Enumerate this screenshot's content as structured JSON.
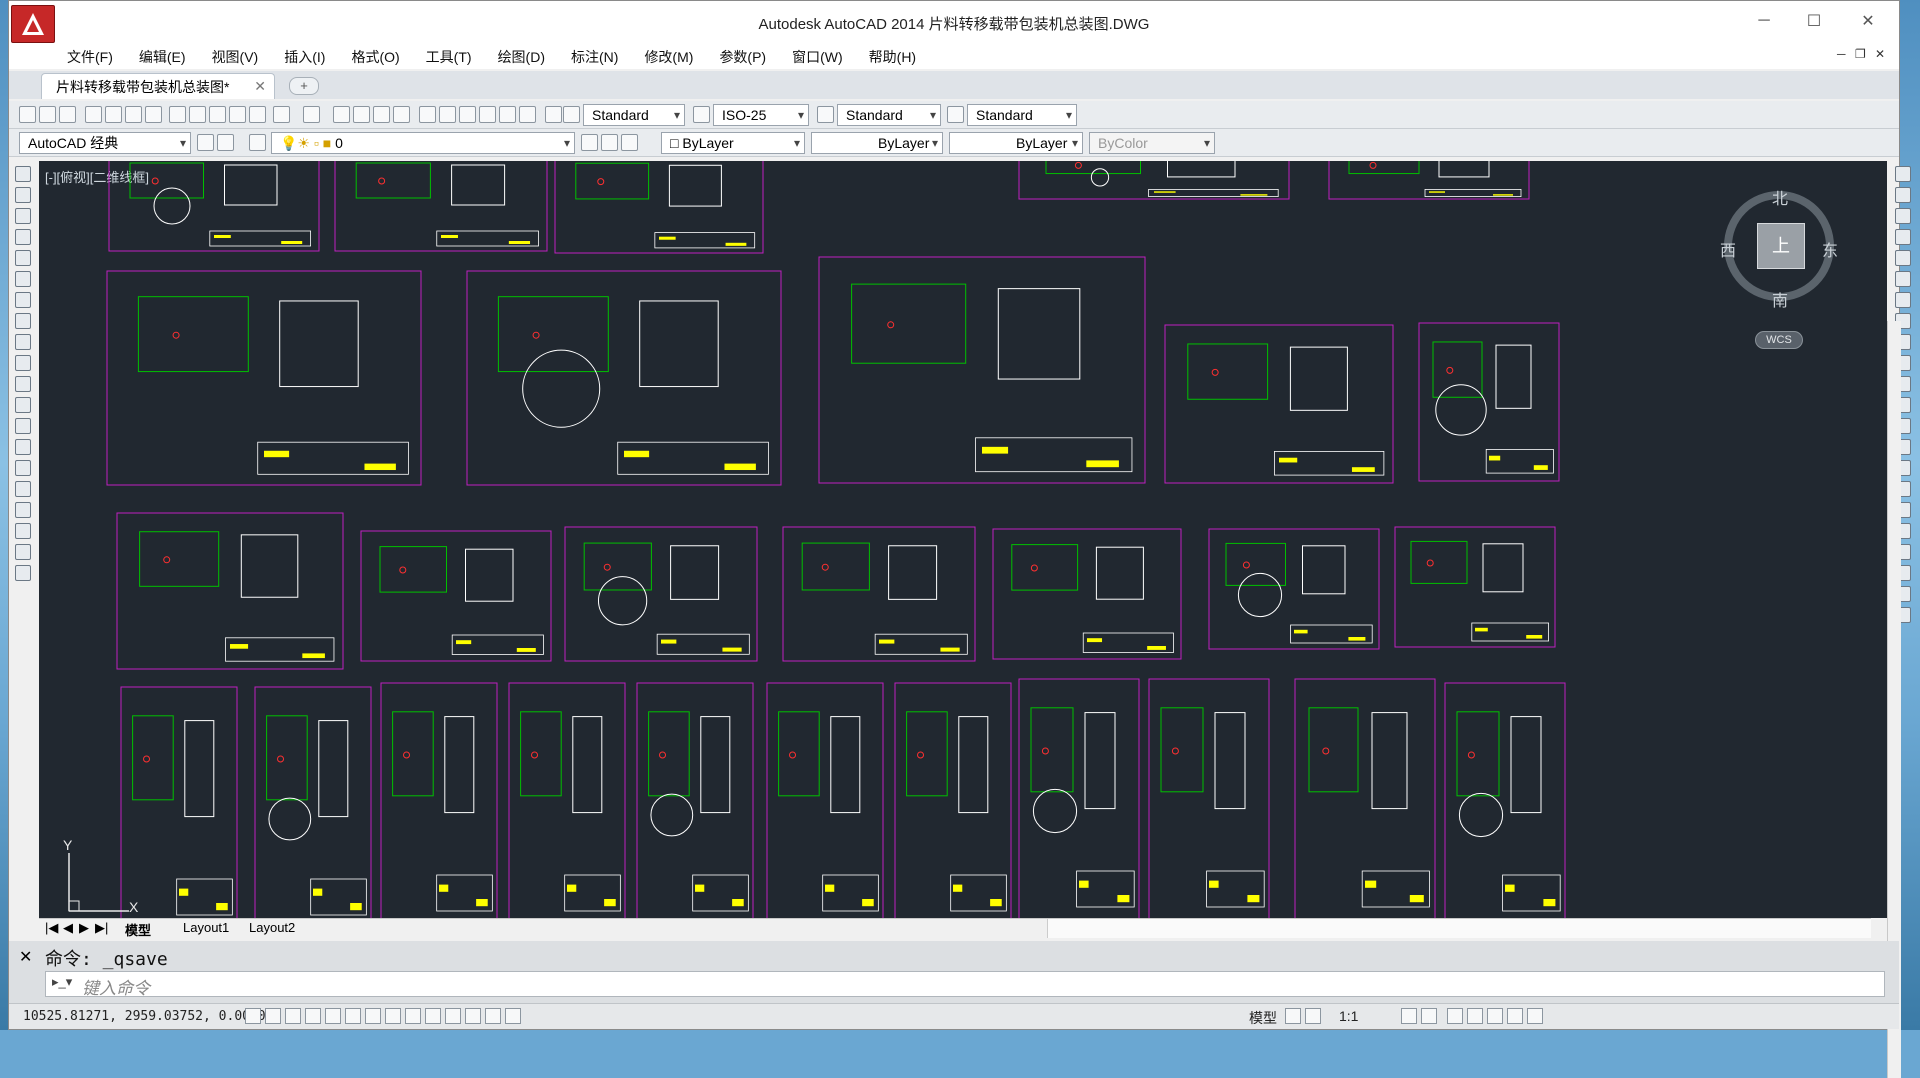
{
  "window": {
    "title": "Autodesk AutoCAD 2014     片料转移载带包装机总装图.DWG",
    "minimize": "─",
    "maximize": "☐",
    "close": "✕"
  },
  "menu": [
    "文件(F)",
    "编辑(E)",
    "视图(V)",
    "插入(I)",
    "格式(O)",
    "工具(T)",
    "绘图(D)",
    "标注(N)",
    "修改(M)",
    "参数(P)",
    "窗口(W)",
    "帮助(H)"
  ],
  "tabs": {
    "doc_tab": "片料转移载带包装机总装图*",
    "doc_close": "✕",
    "new_tab": "+"
  },
  "toolbar1": {
    "text_style": "Standard",
    "dim_style": "ISO-25",
    "table_style": "Standard",
    "mleader_style": "Standard"
  },
  "toolbar2": {
    "workspace": "AutoCAD 经典",
    "layer": "0",
    "color": "ByLayer",
    "linetype": "ByLayer",
    "lineweight": "ByLayer",
    "plotstyle": "ByColor"
  },
  "viewport": {
    "label": "[-][俯视][二维线框]",
    "viewcube_top": "上",
    "north": "北",
    "south": "南",
    "east": "东",
    "west": "西",
    "wcs": "WCS",
    "ucs_y": "Y",
    "ucs_x": "X"
  },
  "layout_tabs": [
    "模型",
    "Layout1",
    "Layout2"
  ],
  "command": {
    "history": "命令: _qsave",
    "placeholder": "键入命令"
  },
  "status": {
    "coords": "10525.81271, 2959.03752, 0.00000",
    "model": "模型",
    "scale": "1:1"
  },
  "colors": {
    "canvas": "#212830",
    "sheet_border": "#c020c0",
    "geometry": "#ffffff",
    "dimensions": "#00c000",
    "highlights": "#ffff00",
    "hatch": "#ff3030"
  }
}
